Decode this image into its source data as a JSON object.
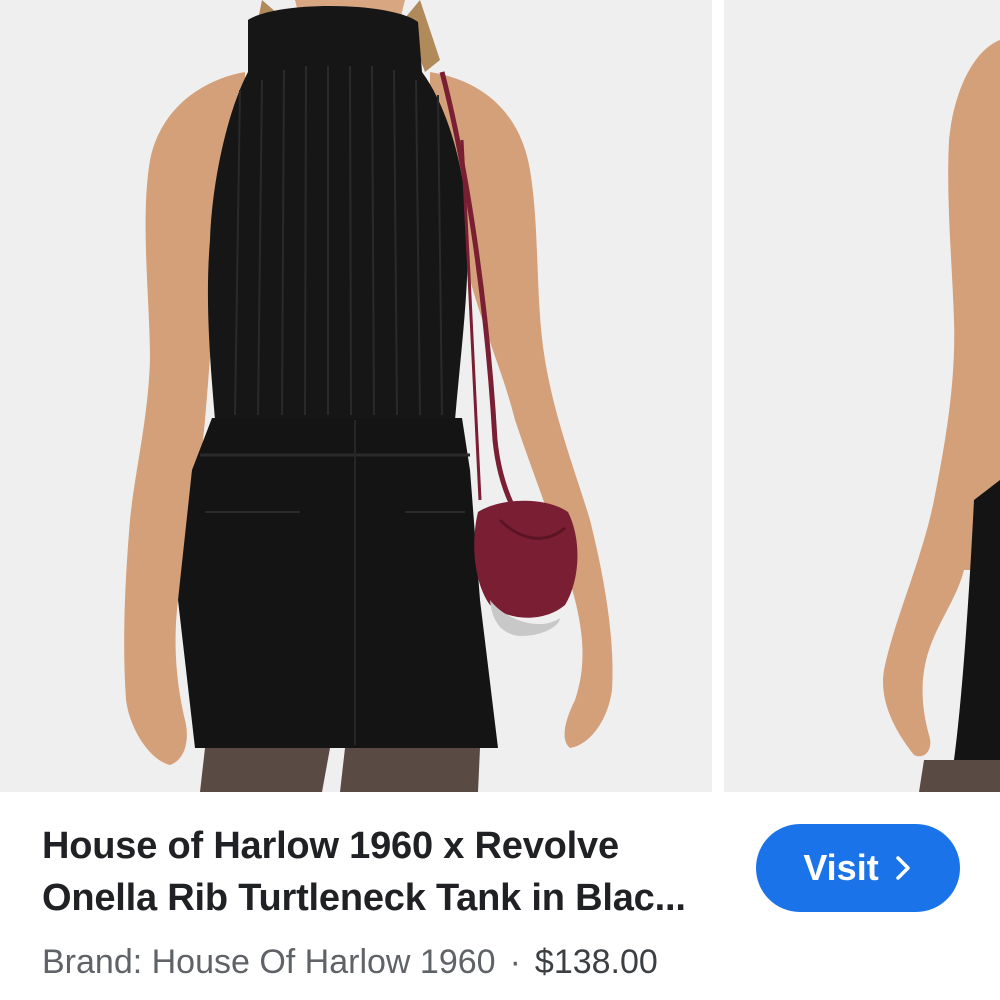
{
  "product": {
    "title_line_1": "House of Harlow 1960 x Revolve",
    "title_line_2": "Onella Rib Turtleneck Tank in Blac...",
    "brand_text": "Brand: House Of Harlow 1960",
    "separator": "·",
    "price": "$138.00"
  },
  "actions": {
    "visit_label": "Visit",
    "visit_icon": "chevron-right-icon"
  },
  "gallery": {
    "images": [
      {
        "name": "product-photo-main",
        "subject": "model wearing black ribbed turtleneck tank, black mini skirt and burgundy crossbody bag"
      },
      {
        "name": "product-photo-next",
        "subject": "partial view of model in black outfit"
      }
    ]
  },
  "colors": {
    "accent": "#1a73e8",
    "title_text": "#202124",
    "meta_text": "#5f6368",
    "photo_background": "#f0efef",
    "bag": "#7a1f33"
  }
}
